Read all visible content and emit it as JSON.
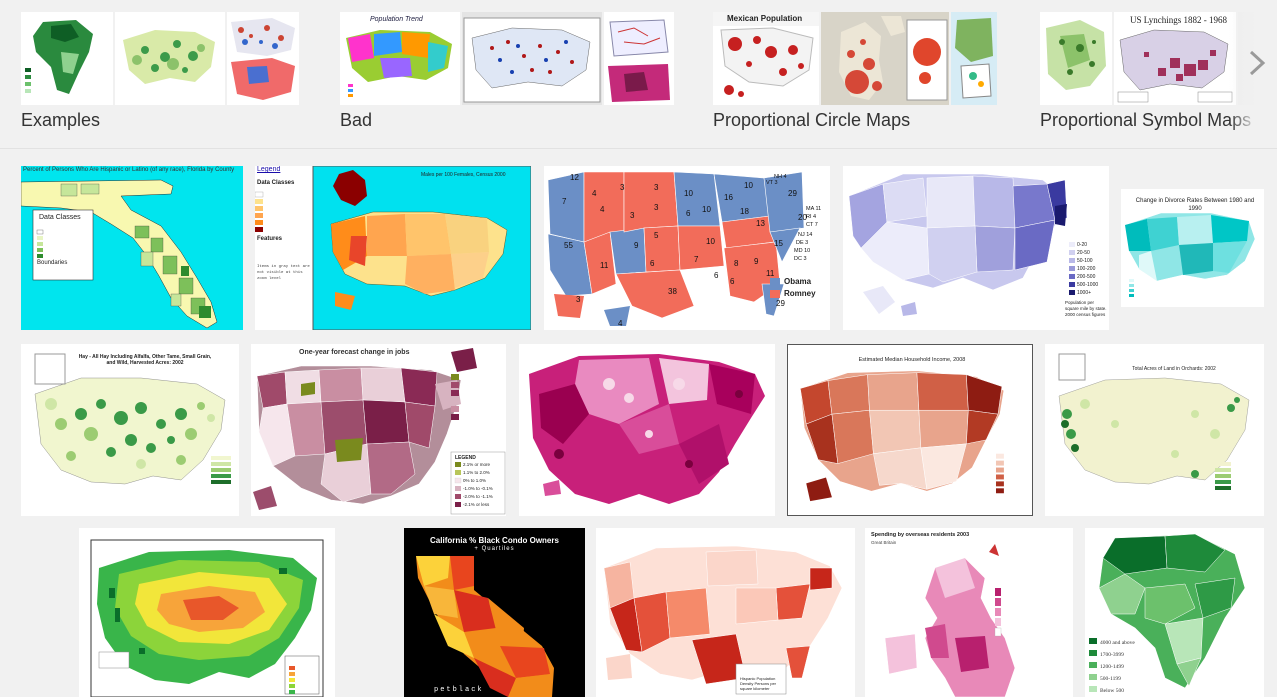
{
  "related": [
    {
      "label": "Examples"
    },
    {
      "label": "Bad"
    },
    {
      "label": "Proportional Circle Maps"
    },
    {
      "label": "Proportional Symbol Maps"
    }
  ],
  "thumb_text": {
    "bad_title": "Population Trend",
    "mexican_title": "Mexican Population",
    "lynch_title": "US Lynchings 1882 - 1968"
  },
  "images": {
    "florida_title": "Percent of Persons Who Are Hispanic or Latino (of any race), Florida by County",
    "florida_legend": "Data Classes",
    "florida_boundaries": "Boundaries",
    "widowed_title": "Males per 100 Females, Census 2000",
    "widowed_legend": "Legend",
    "widowed_data_classes": "Data Classes",
    "widowed_features": "Features",
    "widowed_note": "Items in gray text are not visible at this zoom level",
    "election_obama": "Obama",
    "election_romney": "Romney",
    "density_legend": [
      "0-20",
      "20-50",
      "50-100",
      "100-200",
      "200-500",
      "500-1000",
      "1000+"
    ],
    "density_caption": "Population per square mile by state. 2000 census figures",
    "divorce_title": "Change in Divorce Rates Between 1980 and 1990",
    "hay_title": "Hay - All Hay Including Alfalfa, Other Tame, Small Grain, and Wild, Harvested Acres: 2002",
    "jobs_title": "One-year forecast change in jobs",
    "jobs_legend": [
      "2.1% or more",
      "1.1% to 2.0%",
      "0% to 1.0%",
      "-1.0% to -0.1%",
      "-2.0% to -1.1%",
      "-2.1% or less"
    ],
    "jobs_legend_title": "LEGEND",
    "income_title": "Estimated Median Household Income, 2008",
    "orchards_title": "Total Acres of Land in Orchards: 2002",
    "condo_title": "California % Black Condo Owners",
    "condo_sub": "+ Quartiles",
    "condo_footer": "petblack",
    "hispanic_caption": "Hispanic Population Density Persons per square kilometer",
    "spending_title": "Spending by overseas residents 2003",
    "spending_sub": "Great Britain",
    "africa_legend": [
      "4000 and above",
      "1700-3999",
      "1200-1499",
      "500-1199",
      "Below 500"
    ]
  },
  "colors": {
    "page_bg": "#f1f1f1",
    "label_text": "#333333",
    "obama": "#6b8fc6",
    "romney": "#f26c5a"
  }
}
